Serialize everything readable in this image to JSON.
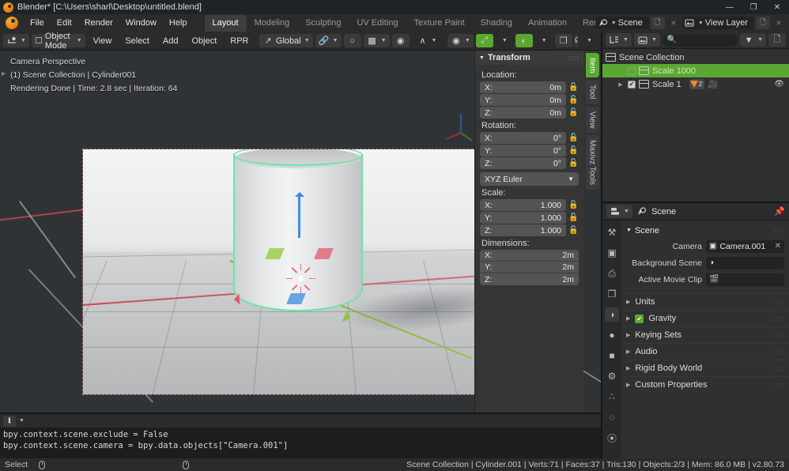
{
  "window": {
    "title": "Blender* [C:\\Users\\sharl\\Desktop\\untitled.blend]",
    "minimize": "—",
    "maximize": "❐",
    "close": "✕"
  },
  "topbar": {
    "menus": [
      "File",
      "Edit",
      "Render",
      "Window",
      "Help"
    ],
    "tabs": [
      {
        "label": "Layout",
        "active": true
      },
      {
        "label": "Modeling",
        "active": false
      },
      {
        "label": "Sculpting",
        "active": false
      },
      {
        "label": "UV Editing",
        "active": false
      },
      {
        "label": "Texture Paint",
        "active": false
      },
      {
        "label": "Shading",
        "active": false
      },
      {
        "label": "Animation",
        "active": false
      },
      {
        "label": "Ren",
        "active": false
      }
    ],
    "scene_name": "Scene",
    "view_layer_name": "View Layer",
    "new_scene_icon": "new-scene-icon",
    "remove_scene_icon": "remove-scene-icon",
    "new_layer_icon": "new-layer-icon",
    "remove_layer_icon": "remove-layer-icon"
  },
  "viewport_header": {
    "editor_type_icon": "editor-type-icon",
    "mode": "Object Mode",
    "menus": [
      "View",
      "Select",
      "Add",
      "Object",
      "RPR"
    ],
    "transform_orientation": "Global",
    "snap_icon": "magnet-icon",
    "proportional_icon": "proportional-edit-icon",
    "falloff_icon": "falloff-curve-icon",
    "visibility_icon": "visibility-icon",
    "gizmo_icon": "gizmo-icon",
    "overlays_icon": "overlays-icon",
    "xray_icon": "xray-icon",
    "shading_modes": [
      "wireframe",
      "solid",
      "material-preview",
      "rendered"
    ],
    "shading_active_index": 3
  },
  "viewport": {
    "info_lines": [
      "Camera Perspective",
      "(1) Scene Collection | Cylinder001",
      "Rendering Done | Time: 2.8 sec | Iteration: 64"
    ]
  },
  "sidebar": {
    "panel_title": "Transform",
    "tabs": [
      {
        "label": "Item",
        "active": true
      },
      {
        "label": "Tool",
        "active": false
      },
      {
        "label": "View",
        "active": false
      },
      {
        "label": "Maxivz Tools",
        "active": false
      }
    ],
    "location": {
      "label": "Location:",
      "fields": [
        {
          "axis": "X:",
          "value": "0m"
        },
        {
          "axis": "Y:",
          "value": "0m"
        },
        {
          "axis": "Z:",
          "value": "0m"
        }
      ]
    },
    "rotation": {
      "label": "Rotation:",
      "fields": [
        {
          "axis": "X:",
          "value": "0°"
        },
        {
          "axis": "Y:",
          "value": "0°"
        },
        {
          "axis": "Z:",
          "value": "0°"
        }
      ],
      "mode": "XYZ Euler"
    },
    "scale": {
      "label": "Scale:",
      "fields": [
        {
          "axis": "X:",
          "value": "1.000"
        },
        {
          "axis": "Y:",
          "value": "1.000"
        },
        {
          "axis": "Z:",
          "value": "1.000"
        }
      ]
    },
    "dimensions": {
      "label": "Dimensions:",
      "fields": [
        {
          "axis": "X:",
          "value": "2m"
        },
        {
          "axis": "Y:",
          "value": "2m"
        },
        {
          "axis": "Z:",
          "value": "2m"
        }
      ]
    },
    "lock_icon": "unlocked-padlock-icon"
  },
  "outliner": {
    "display_mode_icon": "outliner-display-mode-icon",
    "filter_id_icon": "id-type-filter-icon",
    "search_placeholder": "",
    "search_icon": "search-icon",
    "filter_icon": "filter-icon",
    "new_collection_icon": "new-collection-icon",
    "rows": [
      {
        "label": "Scene Collection",
        "indent": 0,
        "selected": false,
        "has_checkbox": false,
        "has_eye": false
      },
      {
        "label": "Scale 1000",
        "indent": 1,
        "selected": true,
        "has_checkbox": true,
        "checked": false,
        "has_eye": false
      },
      {
        "label": "Scale 1",
        "indent": 1,
        "selected": false,
        "has_checkbox": true,
        "checked": true,
        "has_eye": true,
        "mesh_count": "2"
      }
    ]
  },
  "properties": {
    "editor_icon": "properties-editor-icon",
    "breadcrumb_icon": "scene-icon",
    "breadcrumb": "Scene",
    "pin_icon": "pin-icon",
    "tabs": [
      {
        "name": "tool",
        "glyph": "⚒",
        "active": false
      },
      {
        "name": "render",
        "glyph": "▣",
        "active": false
      },
      {
        "name": "output",
        "glyph": "⎙",
        "active": false
      },
      {
        "name": "view-layer",
        "glyph": "❐",
        "active": false
      },
      {
        "name": "scene",
        "glyph": "◑",
        "active": true
      },
      {
        "name": "world",
        "glyph": "●",
        "active": false
      },
      {
        "name": "object",
        "glyph": "■",
        "active": false
      },
      {
        "name": "modifier",
        "glyph": "⚙",
        "active": false
      },
      {
        "name": "particles",
        "glyph": "∴",
        "active": false
      },
      {
        "name": "physics",
        "glyph": "◌",
        "active": false
      },
      {
        "name": "constraints",
        "glyph": "⦿",
        "active": false
      }
    ],
    "panel_title": "Scene",
    "rows": [
      {
        "label": "Camera",
        "value": "Camera.001",
        "icon": "camera-object-icon",
        "clear": "✕"
      },
      {
        "label": "Background Scene",
        "value": "",
        "icon": "scene-icon",
        "clear": ""
      },
      {
        "label": "Active Movie Clip",
        "value": "",
        "icon": "movie-clip-icon",
        "clear": ""
      }
    ],
    "sections": [
      {
        "label": "Units",
        "checkbox": false
      },
      {
        "label": "Gravity",
        "checkbox": true,
        "checked": true
      },
      {
        "label": "Keying Sets",
        "checkbox": false
      },
      {
        "label": "Audio",
        "checkbox": false
      },
      {
        "label": "Rigid Body World",
        "checkbox": false
      },
      {
        "label": "Custom Properties",
        "checkbox": false
      }
    ]
  },
  "info_editor": {
    "editor_icon": "info-editor-icon",
    "lines": [
      "bpy.context.scene.exclude = False",
      "bpy.context.scene.camera = bpy.data.objects[\"Camera.001\"]"
    ]
  },
  "statusbar": {
    "keymap_label": "Select",
    "mouse_left_icon": "mouse-left-icon",
    "mouse_right_icon": "mouse-right-icon",
    "stats": "Scene Collection | Cylinder.001 | Verts:71 | Faces:37 | Tris:130 | Objects:2/3 | Mem: 86.0 MB | v2.80.73"
  },
  "colors": {
    "accent_green": "#5aa832",
    "selection_outline": "#66e8a4",
    "axis_x": "#e05767",
    "axis_y": "#8fc63d",
    "axis_z": "#3b8ee0",
    "orange": "#e88a3c"
  }
}
